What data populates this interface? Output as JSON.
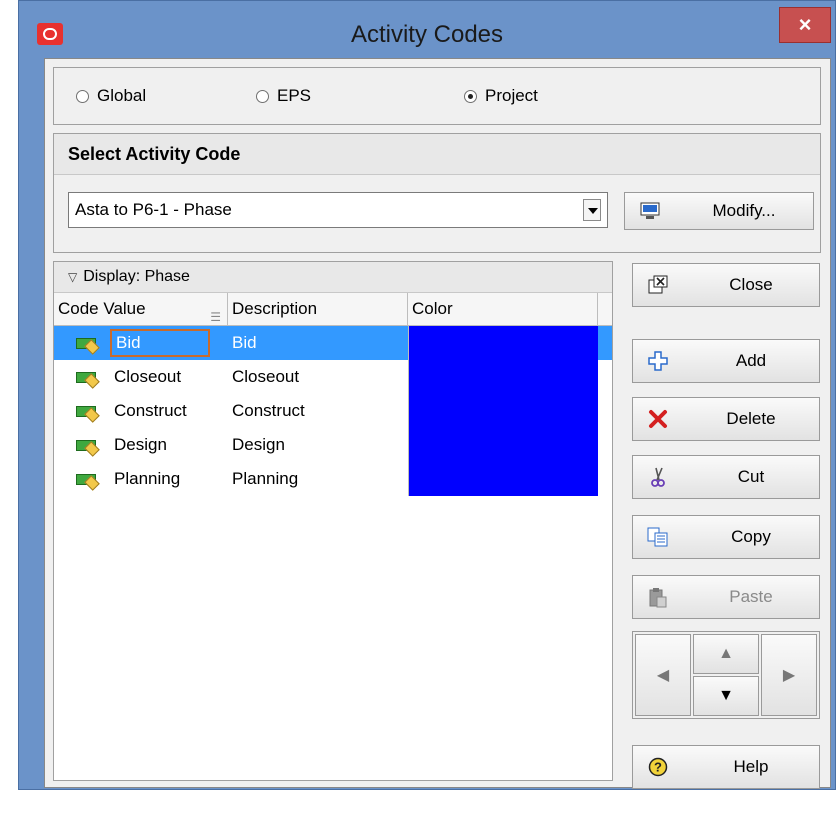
{
  "window": {
    "title": "Activity Codes",
    "close_glyph": "×"
  },
  "scope": {
    "options": [
      {
        "label": "Global",
        "selected": false
      },
      {
        "label": "EPS",
        "selected": false
      },
      {
        "label": "Project",
        "selected": true
      }
    ]
  },
  "select_section": {
    "header": "Select Activity Code",
    "combo_value": "Asta to P6-1 - Phase",
    "modify_label": "Modify..."
  },
  "grid": {
    "title": "Display: Phase",
    "columns": [
      "Code Value",
      "Description",
      "Color"
    ],
    "rows": [
      {
        "code": "Bid",
        "description": "Bid",
        "color": "#0000ff",
        "selected": true
      },
      {
        "code": "Closeout",
        "description": "Closeout",
        "color": "#0000ff"
      },
      {
        "code": "Construct",
        "description": "Construct",
        "color": "#0000ff"
      },
      {
        "code": "Design",
        "description": "Design",
        "color": "#0000ff"
      },
      {
        "code": "Planning",
        "description": "Planning",
        "color": "#0000ff"
      }
    ]
  },
  "buttons": {
    "close": "Close",
    "add": "Add",
    "delete": "Delete",
    "cut": "Cut",
    "copy": "Copy",
    "paste": "Paste",
    "help": "Help"
  }
}
